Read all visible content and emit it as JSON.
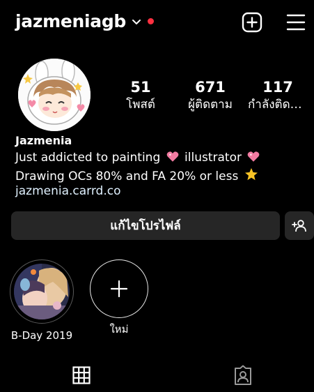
{
  "header": {
    "username": "jazmeniagb",
    "icons": {
      "dropdown": "chevron-down-icon",
      "notification": "notification-dot",
      "create": "plus-square-icon",
      "menu": "hamburger-menu-icon"
    },
    "notification_color": "#ff3040"
  },
  "profile": {
    "avatar_icon": "profile-avatar",
    "stats": [
      {
        "value": "51",
        "label": "โพสต์"
      },
      {
        "value": "671",
        "label": "ผู้ติดตาม"
      },
      {
        "value": "117",
        "label": "กำลังติดตาม"
      }
    ],
    "name": "Jazmenia",
    "bio": {
      "part1": "Just addicted to painting",
      "part2": " illustrator",
      "part3": " Drawing OCs 80%  and FA 20% or less",
      "emoji_heart": "sparkling-heart-icon",
      "emoji_star": "glowing-star-icon"
    },
    "link": "jazmenia.carrd.co"
  },
  "actions": {
    "edit_profile_label": "แก้ไขโปรไฟล์",
    "add_person_icon": "add-person-icon"
  },
  "highlights": [
    {
      "label": "B-Day 2019",
      "icon": "story-highlight-thumbnail"
    },
    {
      "label": "ใหม่",
      "icon": "plus-icon"
    }
  ],
  "tabs": [
    {
      "name": "posts-grid",
      "icon": "grid-icon"
    },
    {
      "name": "tagged",
      "icon": "tagged-person-icon"
    }
  ],
  "colors": {
    "background": "#000000",
    "button": "#262626",
    "link": "#e0f1ff"
  }
}
